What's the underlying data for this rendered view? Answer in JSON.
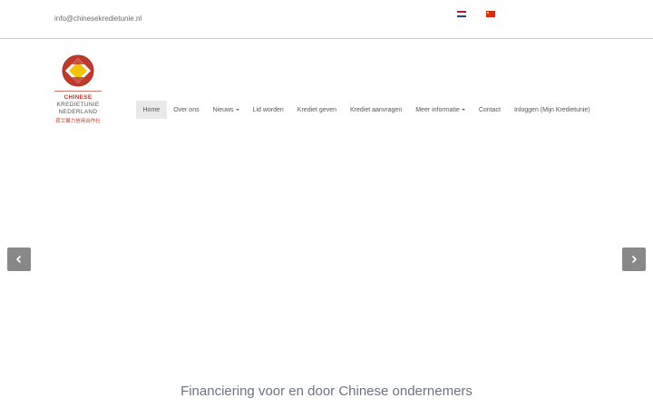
{
  "topbar": {
    "email": "info@chinesekredietunie.nl",
    "flags": [
      "nl-flag-icon",
      "cn-flag-icon"
    ]
  },
  "logo": {
    "line1": "CHINESE",
    "line2": "KREDIETUNIE",
    "line3": "NEDERLAND",
    "line4": "荷兰聚力信用合作社"
  },
  "nav": {
    "items": [
      {
        "label": "Home",
        "active": true
      },
      {
        "label": "Over ons"
      },
      {
        "label": "Nieuws",
        "dropdown": true
      },
      {
        "label": "Lid worden"
      },
      {
        "label": "Krediet geven"
      },
      {
        "label": "Krediet aanvragen"
      },
      {
        "label": "Meer informatie",
        "dropdown": true
      },
      {
        "label": "Contact"
      },
      {
        "label": "Inloggen (Mijn Kredietunie)"
      }
    ]
  },
  "carousel": {
    "prev_icon": "chevron-left-icon",
    "next_icon": "chevron-right-icon"
  },
  "tagline": "Financiering voor en door Chinese ondernemers",
  "colors": {
    "accent_red": "#c0392b",
    "logo_yellow": "#f5c400",
    "carousel_button": "#888888"
  }
}
